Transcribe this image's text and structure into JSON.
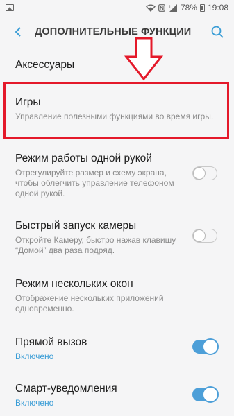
{
  "status": {
    "battery": "78%",
    "time": "19:08"
  },
  "header": {
    "title": "ДОПОЛНИТЕЛЬНЫЕ ФУНКЦИИ"
  },
  "items": [
    {
      "title": "Аксессуары"
    },
    {
      "title": "Игры",
      "subtitle": "Управление полезными функциями во время игры."
    },
    {
      "title": "Режим работы одной рукой",
      "subtitle": "Отрегулируйте размер и схему экрана, чтобы облегчить управление телефоном одной рукой.",
      "toggle": "off"
    },
    {
      "title": "Быстрый запуск камеры",
      "subtitle": "Откройте Камеру, быстро нажав клавишу “Домой” два раза подряд.",
      "toggle": "off"
    },
    {
      "title": "Режим нескольких окон",
      "subtitle": "Отображение нескольких приложений одновременно."
    },
    {
      "title": "Прямой вызов",
      "subtitle": "Включено",
      "toggle": "on"
    },
    {
      "title": "Смарт-уведомления",
      "subtitle": "Включено",
      "toggle": "on"
    }
  ],
  "colors": {
    "accent": "#3a9dd6",
    "highlight": "#e4192a"
  }
}
